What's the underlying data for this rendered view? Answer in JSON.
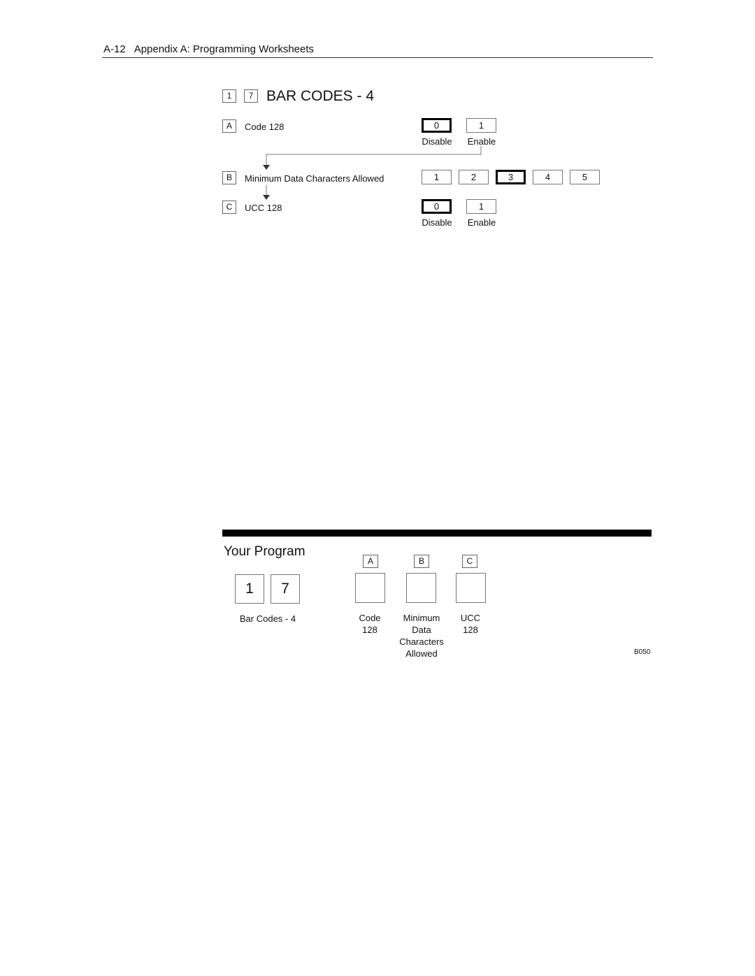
{
  "header": {
    "page_number": "A-12",
    "title": "Appendix A:  Programming Worksheets"
  },
  "section": {
    "codes": [
      "1",
      "7"
    ],
    "title": "BAR CODES - 4"
  },
  "parameters": [
    {
      "key": "A",
      "label": "Code 128",
      "options": [
        {
          "value": "0",
          "caption": "Disable",
          "selected": true
        },
        {
          "value": "1",
          "caption": "Enable",
          "selected": false
        }
      ]
    },
    {
      "key": "B",
      "label": "Minimum Data Characters Allowed",
      "options": [
        {
          "value": "1",
          "selected": false
        },
        {
          "value": "2",
          "selected": false
        },
        {
          "value": "3",
          "selected": true
        },
        {
          "value": "4",
          "selected": false
        },
        {
          "value": "5",
          "selected": false
        }
      ]
    },
    {
      "key": "C",
      "label": "UCC 128",
      "options": [
        {
          "value": "0",
          "caption": "Disable",
          "selected": true
        },
        {
          "value": "1",
          "caption": "Enable",
          "selected": false
        }
      ]
    }
  ],
  "your_program": {
    "title": "Your Program",
    "codes": [
      "1",
      "7"
    ],
    "codes_caption": "Bar Codes - 4",
    "fields": [
      {
        "key": "A",
        "caption_lines": [
          "Code",
          "128"
        ]
      },
      {
        "key": "B",
        "caption_lines": [
          "Minimum",
          "Data",
          "Characters",
          "Allowed"
        ]
      },
      {
        "key": "C",
        "caption_lines": [
          "UCC",
          "128"
        ]
      }
    ],
    "figure_code": "B050"
  }
}
